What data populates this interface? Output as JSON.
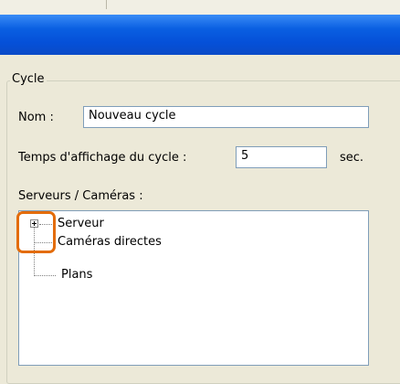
{
  "window": {
    "title": ""
  },
  "cycle": {
    "group_label": "Cycle",
    "name_label": "Nom :",
    "name_value": "Nouveau cycle",
    "duration_label": "Temps d'affichage du cycle :",
    "duration_value": "5",
    "duration_unit": "sec.",
    "servers_label": "Serveurs / Caméras :"
  },
  "tree": {
    "nodes": [
      {
        "label": "Serveur",
        "expandable": true
      },
      {
        "label": "Caméras directes",
        "expandable": false
      },
      {
        "label": "Plans",
        "expandable": false
      }
    ]
  },
  "colors": {
    "titlebar": "#0550d8",
    "highlight": "#e36c0a",
    "field_border": "#7f9db9",
    "dialog_background": "#ece9d8"
  }
}
